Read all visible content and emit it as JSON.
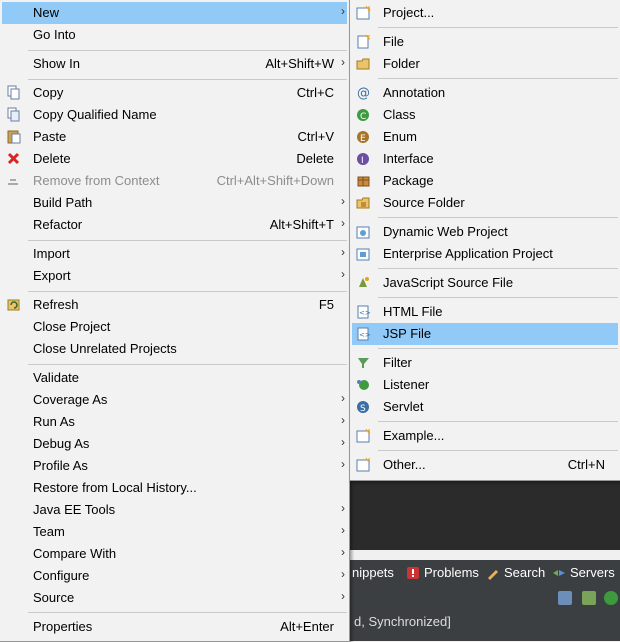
{
  "main_menu": {
    "items": [
      {
        "label": "New",
        "shortcut": "",
        "submenu": true,
        "highlight": true
      },
      {
        "label": "Go Into",
        "shortcut": ""
      },
      {
        "label": "Show In",
        "shortcut": "Alt+Shift+W",
        "submenu": true
      },
      {
        "label": "Copy",
        "shortcut": "Ctrl+C"
      },
      {
        "label": "Copy Qualified Name",
        "shortcut": ""
      },
      {
        "label": "Paste",
        "shortcut": "Ctrl+V"
      },
      {
        "label": "Delete",
        "shortcut": "Delete"
      },
      {
        "label": "Remove from Context",
        "shortcut": "Ctrl+Alt+Shift+Down",
        "disabled": true
      },
      {
        "label": "Build Path",
        "shortcut": "",
        "submenu": true
      },
      {
        "label": "Refactor",
        "shortcut": "Alt+Shift+T",
        "submenu": true
      },
      {
        "label": "Import",
        "shortcut": "",
        "submenu": true
      },
      {
        "label": "Export",
        "shortcut": "",
        "submenu": true
      },
      {
        "label": "Refresh",
        "shortcut": "F5"
      },
      {
        "label": "Close Project",
        "shortcut": ""
      },
      {
        "label": "Close Unrelated Projects",
        "shortcut": ""
      },
      {
        "label": "Validate",
        "shortcut": ""
      },
      {
        "label": "Coverage As",
        "shortcut": "",
        "submenu": true
      },
      {
        "label": "Run As",
        "shortcut": "",
        "submenu": true
      },
      {
        "label": "Debug As",
        "shortcut": "",
        "submenu": true
      },
      {
        "label": "Profile As",
        "shortcut": "",
        "submenu": true
      },
      {
        "label": "Restore from Local History...",
        "shortcut": ""
      },
      {
        "label": "Java EE Tools",
        "shortcut": "",
        "submenu": true
      },
      {
        "label": "Team",
        "shortcut": "",
        "submenu": true
      },
      {
        "label": "Compare With",
        "shortcut": "",
        "submenu": true
      },
      {
        "label": "Configure",
        "shortcut": "",
        "submenu": true
      },
      {
        "label": "Source",
        "shortcut": "",
        "submenu": true
      },
      {
        "label": "Properties",
        "shortcut": "Alt+Enter"
      }
    ]
  },
  "new_submenu": {
    "items": [
      {
        "label": "Project...",
        "shortcut": ""
      },
      {
        "label": "File",
        "shortcut": ""
      },
      {
        "label": "Folder",
        "shortcut": ""
      },
      {
        "label": "Annotation",
        "shortcut": ""
      },
      {
        "label": "Class",
        "shortcut": ""
      },
      {
        "label": "Enum",
        "shortcut": ""
      },
      {
        "label": "Interface",
        "shortcut": ""
      },
      {
        "label": "Package",
        "shortcut": ""
      },
      {
        "label": "Source Folder",
        "shortcut": ""
      },
      {
        "label": "Dynamic Web Project",
        "shortcut": ""
      },
      {
        "label": "Enterprise Application Project",
        "shortcut": ""
      },
      {
        "label": "JavaScript Source File",
        "shortcut": ""
      },
      {
        "label": "HTML File",
        "shortcut": ""
      },
      {
        "label": "JSP File",
        "shortcut": "",
        "highlight": true
      },
      {
        "label": "Filter",
        "shortcut": ""
      },
      {
        "label": "Listener",
        "shortcut": ""
      },
      {
        "label": "Servlet",
        "shortcut": ""
      },
      {
        "label": "Example...",
        "shortcut": ""
      },
      {
        "label": "Other...",
        "shortcut": "Ctrl+N"
      }
    ]
  },
  "bottom_tabs": {
    "snippets": "nippets",
    "problems": "Problems",
    "search": "Search",
    "servers": "Servers"
  },
  "status_text": "d, Synchronized]",
  "arrow_glyph": "›",
  "colors": {
    "highlight": "#91c9f7",
    "menu_bg": "#f2f2f2",
    "ide_dark": "#2b2b2b"
  }
}
